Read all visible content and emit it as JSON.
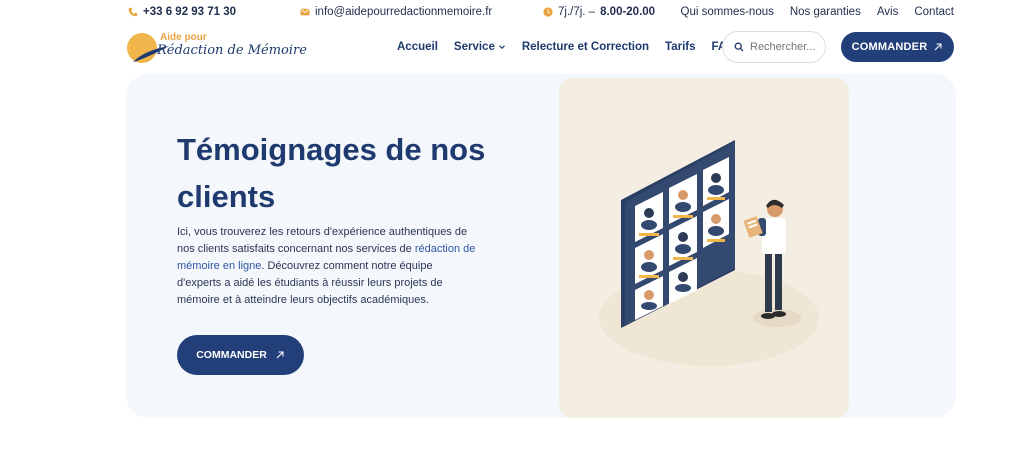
{
  "topbar": {
    "phone": "+33 6 92 93 71 30",
    "email": "info@aidepourredactionmemoire.fr",
    "hours_days": "7j./7j. –",
    "hours_time": "8.00-20.00",
    "links": [
      "Qui sommes-nous",
      "Nos garanties",
      "Avis",
      "Contact"
    ]
  },
  "logo": {
    "small": "Aide pour",
    "main": "Rédaction de Mémoire"
  },
  "nav": {
    "items": [
      "Accueil",
      "Service",
      "Relecture et Correction",
      "Tarifs",
      "FAQ"
    ]
  },
  "search": {
    "placeholder": "Rechercher..."
  },
  "header": {
    "order_label": "COMMANDER"
  },
  "hero": {
    "title": "Témoignages de nos clients",
    "text_1": "Ici, vous trouverez les retours d'expérience authentiques de nos clients satisfaits concernant nos services de ",
    "text_link": "rédaction de mémoire en ligne",
    "text_2": ". Découvrez comment notre équipe d'experts a aidé les étudiants à réussir leurs projets de mémoire et à atteindre leurs objectifs académiques.",
    "order_label": "COMMANDER"
  },
  "colors": {
    "primary": "#233f7a",
    "accent": "#e9a440",
    "hero_bg": "#f4f7fb",
    "illustration_bg": "#f4eee2"
  }
}
